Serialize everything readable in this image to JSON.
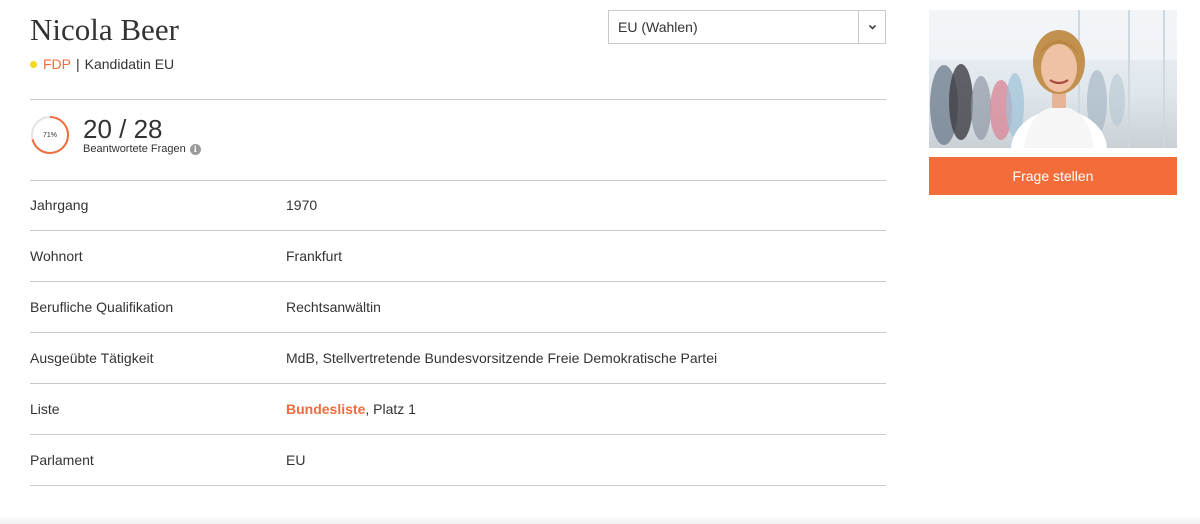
{
  "candidate": {
    "name": "Nicola Beer",
    "party": "FDP",
    "party_color": "#f4d81b",
    "separator": "|",
    "role": "Kandidatin EU"
  },
  "parliament_select": {
    "value": "EU (Wahlen)",
    "icon": "chevron-down-icon"
  },
  "progress": {
    "percent_label": "71%",
    "percent": 71,
    "count": "20 / 28",
    "label": "Beantwortete Fragen",
    "info_icon": "info-icon"
  },
  "details": [
    {
      "label": "Jahrgang",
      "value": "1970"
    },
    {
      "label": "Wohnort",
      "value": "Frankfurt"
    },
    {
      "label": "Berufliche Qualifikation",
      "value": "Rechtsanwältin"
    },
    {
      "label": "Ausgeübte Tätigkeit",
      "value": "MdB, Stellvertretende Bundesvorsitzende Freie Demokratische Partei"
    },
    {
      "label": "Liste",
      "link": "Bundesliste",
      "value_suffix": ", Platz 1"
    },
    {
      "label": "Parlament",
      "value": "EU"
    }
  ],
  "sidebar": {
    "ask_button": "Frage stellen",
    "accent_color": "#f26d3a"
  }
}
